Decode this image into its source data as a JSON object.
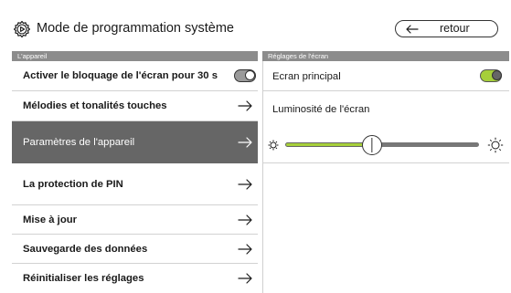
{
  "header": {
    "title": "Mode de programmation système",
    "back_label": "retour",
    "icons": {
      "settings": "gear-play-icon",
      "back": "arrow-left-icon"
    }
  },
  "left_panel": {
    "heading": "L'appareil",
    "items": [
      {
        "label": "Activer le bloquage de l'écran pour 30 s",
        "control": "toggle",
        "state": "off"
      },
      {
        "label": "Mélodies et tonalités touches",
        "control": "arrow"
      },
      {
        "label": "Paramètres de l'appareil",
        "control": "arrow",
        "selected": true
      },
      {
        "label": "La protection de PIN",
        "control": "arrow"
      },
      {
        "label": "Mise à jour",
        "control": "arrow"
      },
      {
        "label": "Sauvegarde des données",
        "control": "arrow"
      },
      {
        "label": "Réinitialiser les réglages",
        "control": "arrow"
      }
    ]
  },
  "right_panel": {
    "heading": "Réglages de l'écran",
    "main_screen": {
      "label": "Ecran principal",
      "state": "on"
    },
    "brightness": {
      "label": "Luminosité de l'écran",
      "value_percent": 44,
      "icons": [
        "brightness-low-icon",
        "brightness-high-icon"
      ]
    }
  },
  "colors": {
    "accent": "#a6cf3a",
    "header_bar": "#8c8c8c",
    "selected_row": "#666666"
  }
}
